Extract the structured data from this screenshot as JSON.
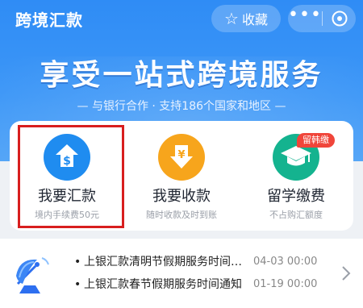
{
  "header": {
    "title": "跨境汇款",
    "favorite_label": "收藏"
  },
  "banner": {
    "headline": "享受一站式跨境服务",
    "subline": "— 与银行合作 · 支持186个国家和地区 —"
  },
  "services": [
    {
      "label": "我要汇款",
      "desc": "境内手续费50元",
      "icon": "dollar-upload-icon",
      "color": "#1f8cf0"
    },
    {
      "label": "我要收款",
      "desc": "随时收款及时到账",
      "icon": "yen-download-icon",
      "color": "#f7a51c"
    },
    {
      "label": "留学缴费",
      "desc": "不占购汇额度",
      "icon": "graduation-cap-icon",
      "color": "#14b38f",
      "badge": "留韩缴"
    }
  ],
  "notices": [
    {
      "text": "上银汇款清明节假期服务时间通知",
      "date": "04-03 00:00"
    },
    {
      "text": "上银汇款春节假期服务时间通知",
      "date": "01-19 00:00"
    }
  ],
  "colors": {
    "brand_blue": "#2f8cf5",
    "highlight_red": "#d81e1e",
    "badge_red": "#f0453a"
  }
}
